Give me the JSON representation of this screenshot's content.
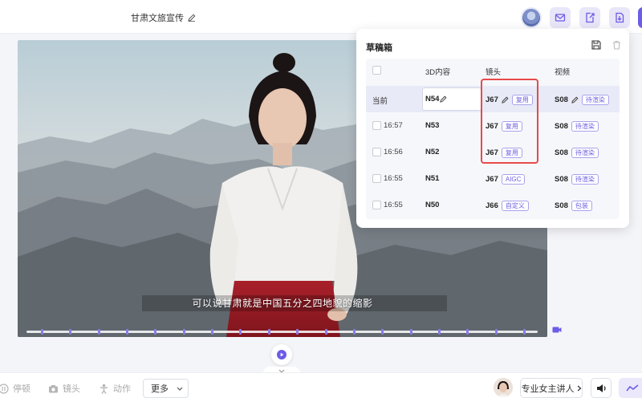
{
  "header": {
    "project_title": "甘肃文旅宣传",
    "buttons": [
      {
        "name": "mail-icon"
      },
      {
        "name": "export-icon"
      },
      {
        "name": "download-icon"
      }
    ]
  },
  "preview": {
    "subtitle": "可以说甘肃就是中国五分之四地貌的缩影",
    "timeline_ticks": 18
  },
  "drafts": {
    "title": "草稿箱",
    "columns": {
      "content_3d": "3D内容",
      "shot": "镜头",
      "video": "视频"
    },
    "rows": [
      {
        "time": "当前",
        "is_current": true,
        "content_3d": "N54",
        "shot": "J67",
        "shot_tag": "复用",
        "video": "S08",
        "video_tag": "待渲染"
      },
      {
        "time": "16:57",
        "is_current": false,
        "content_3d": "N53",
        "shot": "J67",
        "shot_tag": "复用",
        "video": "S08",
        "video_tag": "待渲染"
      },
      {
        "time": "16:56",
        "is_current": false,
        "content_3d": "N52",
        "shot": "J67",
        "shot_tag": "复用",
        "video": "S08",
        "video_tag": "待渲染"
      },
      {
        "time": "16:55",
        "is_current": false,
        "content_3d": "N51",
        "shot": "J67",
        "shot_tag": "AIGC",
        "video": "S08",
        "video_tag": "待渲染"
      },
      {
        "time": "16:55",
        "is_current": false,
        "content_3d": "N50",
        "shot": "J66",
        "shot_tag": "自定义",
        "video": "S08",
        "video_tag": "包装"
      }
    ]
  },
  "toolbar": {
    "pause_label": "停顿",
    "camera_label": "镜头",
    "action_label": "动作",
    "more_label": "更多",
    "presenter_label": "专业女主讲人"
  },
  "colors": {
    "accent": "#6c5ce7",
    "tag_border": "#a9a2ec",
    "highlight": "#e84a4a"
  }
}
